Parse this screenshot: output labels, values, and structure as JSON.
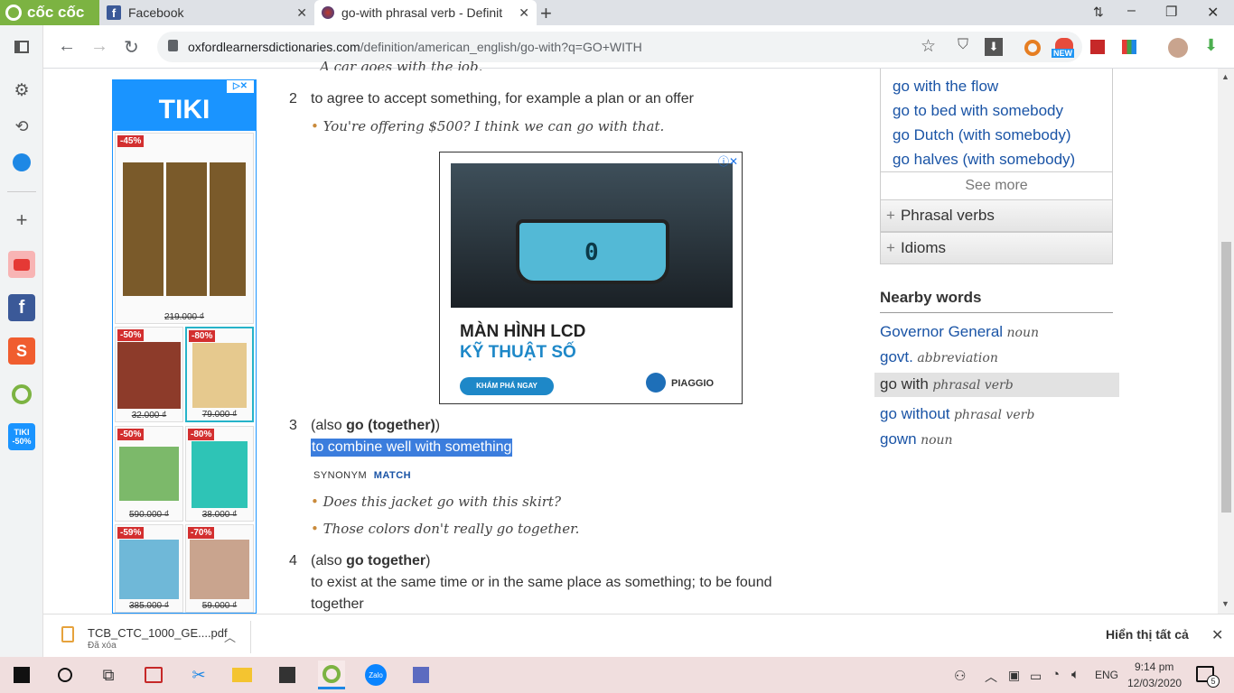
{
  "tabs": {
    "coccoc": "cốc cốc",
    "facebook": "Facebook",
    "active": "go-with phrasal verb - Definit",
    "new_tab": "+"
  },
  "window_controls": {
    "minimize": "–",
    "maximize": "❐",
    "close": "✕",
    "restore_menu": "⇅"
  },
  "address": {
    "host": "oxfordlearnersdictionaries.com",
    "path": "/definition/american_english/go-with?q=GO+WITH"
  },
  "toolbar_icons": [
    "star-icon",
    "shield-icon",
    "download-icon",
    "coccoc-icon",
    "new-ext-icon",
    "red-ext-icon",
    "colorful-ext-icon",
    "avatar-icon",
    "green-download-icon"
  ],
  "new_badge": "NEW",
  "sidebar_icons": [
    "panel-icon",
    "settings-icon",
    "history-icon",
    "messenger-icon",
    "add-icon",
    "youtube-icon",
    "facebook-icon",
    "shopee-icon",
    "coccoc-green-icon",
    "tiki-icon"
  ],
  "tiki_side": {
    "line1": "TIKI",
    "line2": "-50%"
  },
  "tiki_ad": {
    "logo": "TIKI",
    "items": [
      {
        "discount": "-45%",
        "price": "219.000 ₫"
      },
      {
        "discount": "-50%",
        "price": "32.000 ₫"
      },
      {
        "discount": "-80%",
        "price": "79.000 ₫"
      },
      {
        "discount": "-50%",
        "price": "590.000 ₫"
      },
      {
        "discount": "-80%",
        "price": "38.000 ₫"
      },
      {
        "discount": "-59%",
        "price": "385.000 ₫"
      },
      {
        "discount": "-70%",
        "price": "59.000 ₫"
      }
    ]
  },
  "entry": {
    "top_cut_example": "A car goes with the job.",
    "sense2": {
      "num": "2",
      "def": "to agree to accept something, for example a plan or an offer",
      "ex": "You're offering $500? I think we can go with that."
    },
    "sense3": {
      "num": "3",
      "also_prefix": "(also ",
      "also_word": "go (together)",
      "also_suffix": ")",
      "def": "to combine well with something",
      "syn_label": "SYNONYM",
      "syn_word": "MATCH",
      "ex1": "Does this jacket go with this skirt?",
      "ex2": "Those colors don't really go together."
    },
    "sense4": {
      "num": "4",
      "also_prefix": "(also ",
      "also_word": "go together",
      "also_suffix": ")",
      "def1": "to exist at the same time or in the same place as something; to be found",
      "def2": "together"
    }
  },
  "center_ad": {
    "headline1": "MÀN HÌNH LCD",
    "headline2": "KỸ THUẬT SỐ",
    "cta": "KHÁM PHÁ NGAY",
    "brand": "PIAGGIO",
    "dash_value": "0"
  },
  "right_panel": {
    "links": [
      "go with the flow",
      "go to bed with somebody",
      "go Dutch (with somebody)",
      "go halves (with somebody)"
    ],
    "see_more": "See more",
    "phrasal_verbs": "Phrasal verbs",
    "idioms": "Idioms",
    "nearby_title": "Nearby words",
    "nearby": [
      {
        "word": "Governor General",
        "pos": "noun"
      },
      {
        "word": "govt.",
        "pos": "abbreviation"
      },
      {
        "word": "go with",
        "pos": "phrasal verb"
      },
      {
        "word": "go without",
        "pos": "phrasal verb"
      },
      {
        "word": "gown",
        "pos": "noun"
      }
    ]
  },
  "download": {
    "file": "TCB_CTC_1000_GE....pdf",
    "status": "Đã xóa",
    "show_all": "Hiển thị tất cả"
  },
  "taskbar": {
    "lang": "ENG",
    "time": "9:14 pm",
    "date": "12/03/2020",
    "notif": "5",
    "zalo": "Zalo"
  }
}
